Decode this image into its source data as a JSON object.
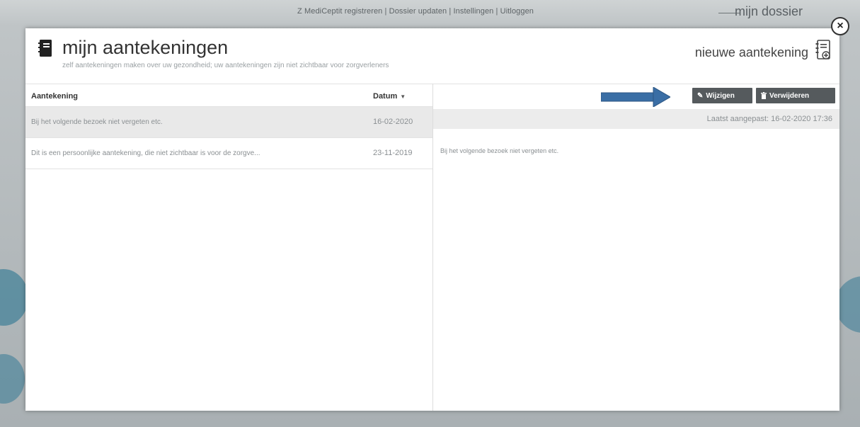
{
  "background": {
    "topnav": "Z MediCeptit registreren  |  Dossier updaten  |  Instellingen  |  Uitloggen",
    "mijn_dossier": "mijn dossier"
  },
  "modal": {
    "title": "mijn aantekeningen",
    "subtitle": "zelf aantekeningen maken over uw gezondheid; uw aantekeningen zijn niet zichtbaar voor zorgverleners",
    "new_note_label": "nieuwe aantekening",
    "close_symbol": "×",
    "list": {
      "col_note": "Aantekening",
      "col_date": "Datum",
      "sort_caret": "▼",
      "rows": [
        {
          "text": "Bij het volgende bezoek niet vergeten etc.",
          "date": "16-02-2020",
          "selected": true
        },
        {
          "text": "Dit is een persoonlijke aantekening, die niet zichtbaar is voor de zorgve...",
          "date": "23-11-2019",
          "selected": false
        }
      ]
    },
    "detail": {
      "edit_label": "Wijzigen",
      "delete_label": "Verwijderen",
      "modified_text": "Laatst aangepast: 16-02-2020 17:36",
      "body": "Bij het volgende bezoek niet vergeten etc."
    }
  },
  "colors": {
    "button_bg": "#555a5d",
    "arrow": "#3a6ea5",
    "selected_row": "#e9e9e9"
  },
  "icons": [
    "notebook-icon",
    "new-note-icon",
    "pencil-icon",
    "trash-icon",
    "close-icon",
    "arrow-right-icon"
  ]
}
